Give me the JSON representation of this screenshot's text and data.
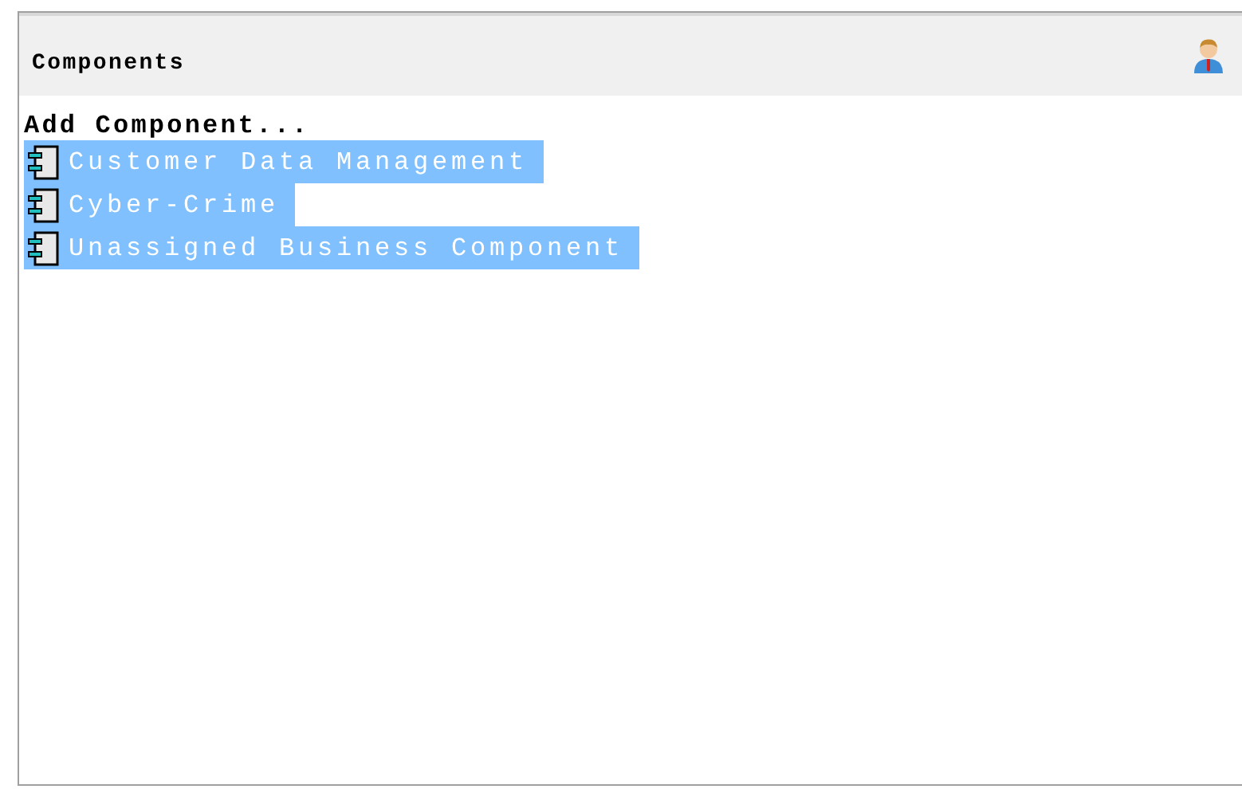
{
  "panel": {
    "title": "Components"
  },
  "add_link": "Add Component...",
  "components": [
    {
      "name": "Customer Data Management",
      "selected": true
    },
    {
      "name": "Cyber-Crime",
      "selected": true
    },
    {
      "name": "Unassigned Business Component",
      "selected": true
    }
  ]
}
